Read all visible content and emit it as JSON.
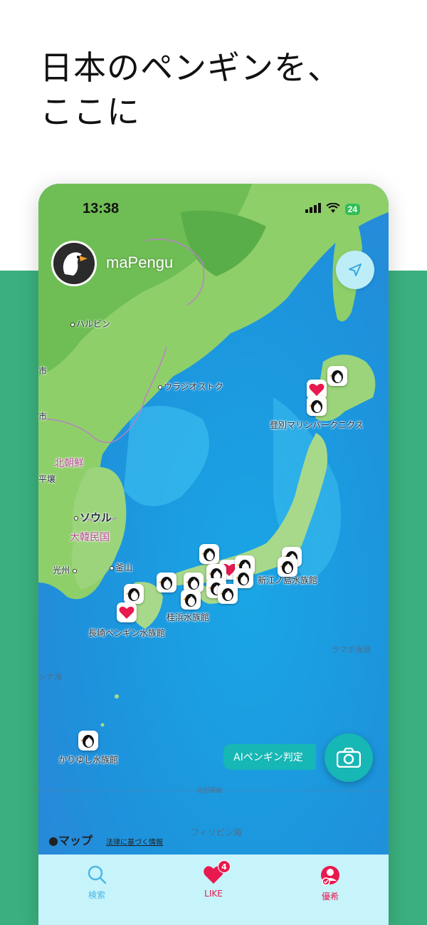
{
  "promo": {
    "title": "日本のペンギンを、\nここに"
  },
  "status_bar": {
    "time": "13:38",
    "battery": "24"
  },
  "header": {
    "app_name": "maPengu"
  },
  "map": {
    "labels": {
      "harbin": "ハルビン",
      "vladivostok": "ウラジオストク",
      "north_korea": "北朝鮮",
      "pyongyang": "平壌",
      "seoul": "ソウル",
      "south_korea": "大韓民国",
      "busan": "釜山",
      "gwangju": "光州",
      "city_edge_1": "市",
      "city_edge_2": "市",
      "east_china_sea": "シナ海",
      "ramapo": "ラマポ海淵",
      "tropic": "北回帰線",
      "philippine_sea": "フィリピン海"
    },
    "places": {
      "noboribetsu": "登別マリンパークニクス",
      "enoshima": "新江ノ島水族館",
      "katsurahama": "桂浜水族館",
      "nagasaki": "長崎ペンギン水族館",
      "kariyushi": "かりゆし水族館"
    },
    "attribution": "マップ",
    "legal": "法律に基づく情報"
  },
  "actions": {
    "ai_judge": "AIペンギン判定"
  },
  "tabs": {
    "search": "検索",
    "like": "LIKE",
    "like_badge": "4",
    "rare": "優希"
  },
  "colors": {
    "brand_green": "#3bb07e",
    "accent_teal": "#16b7b4",
    "like_red": "#e8194f",
    "tab_bar_bg": "#c7f3fa"
  }
}
